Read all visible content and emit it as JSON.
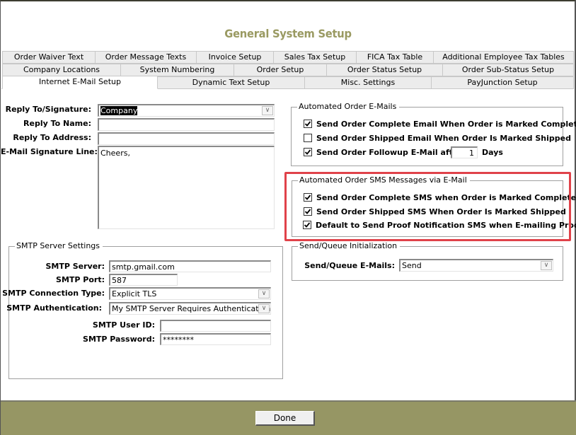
{
  "window": {
    "title": "General System Setup"
  },
  "tabs": {
    "row1": [
      {
        "label": "Order Waiver Text"
      },
      {
        "label": "Order Message Texts"
      },
      {
        "label": "Invoice Setup"
      },
      {
        "label": "Sales Tax Setup"
      },
      {
        "label": "FICA Tax Table"
      },
      {
        "label": "Additional Employee Tax Tables"
      }
    ],
    "row2": [
      {
        "label": "Company Locations"
      },
      {
        "label": "System Numbering"
      },
      {
        "label": "Order Setup"
      },
      {
        "label": "Order Status Setup"
      },
      {
        "label": "Order Sub-Status Setup"
      }
    ],
    "row3": [
      {
        "label": "Internet E-Mail Setup",
        "active": true
      },
      {
        "label": "Dynamic Text Setup"
      },
      {
        "label": "Misc. Settings"
      },
      {
        "label": "PayJunction Setup"
      }
    ]
  },
  "reply": {
    "signature_label": "Reply To/Signature:",
    "signature_value": "Company",
    "name_label": "Reply To Name:",
    "name_value": "",
    "address_label": "Reply To Address:",
    "address_value": "",
    "signature_line_label": "E-Mail Signature Line:",
    "signature_line_value": "Cheers,"
  },
  "smtp": {
    "group_title": "SMTP Server Settings",
    "server_label": "SMTP Server:",
    "server_value": "smtp.gmail.com",
    "port_label": "SMTP Port:",
    "port_value": "587",
    "connection_label": "SMTP Connection Type:",
    "connection_value": "Explicit TLS",
    "auth_label": "SMTP Authentication:",
    "auth_value": "My SMTP Server Requires Authentication",
    "user_label": "SMTP User ID:",
    "user_value": "",
    "password_label": "SMTP Password:",
    "password_value": "********"
  },
  "auto_emails": {
    "group_title": "Automated Order E-Mails",
    "items": [
      {
        "label": "Send Order Complete Email When Order is Marked Complete",
        "checked": true
      },
      {
        "label": "Send Order Shipped Email When Order Is Marked Shipped",
        "checked": false
      },
      {
        "label": "Send Order Followup E-Mail after",
        "checked": true
      }
    ],
    "followup_days_value": "1",
    "days_label": "Days"
  },
  "auto_sms": {
    "group_title": "Automated Order SMS Messages via E-Mail",
    "items": [
      {
        "label": "Send Order Complete SMS when Order is Marked Complete",
        "checked": true
      },
      {
        "label": "Send Order Shipped SMS When Order Is Marked Shipped",
        "checked": true
      },
      {
        "label": "Default to Send Proof Notification SMS when E-mailing Proof",
        "checked": true
      }
    ],
    "highlight_color": "#e0424a"
  },
  "send_queue": {
    "group_title": "Send/Queue Initialization",
    "label": "Send/Queue E-Mails:",
    "value": "Send"
  },
  "footer": {
    "done_label": "Done",
    "background_color": "#969664"
  },
  "icons": {
    "dropdown": "∨"
  }
}
